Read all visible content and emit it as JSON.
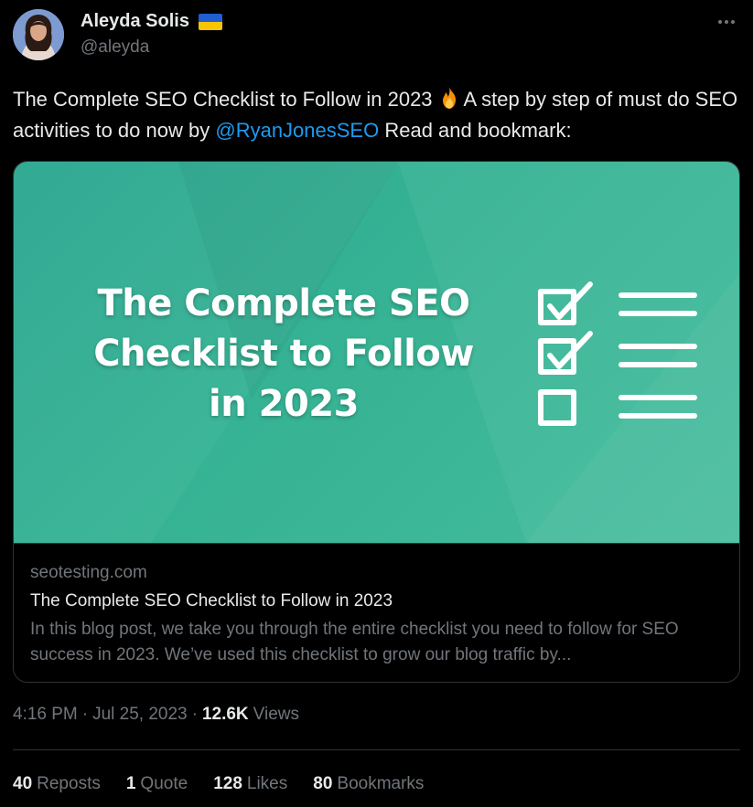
{
  "author": {
    "display_name": "Aleyda Solis",
    "handle": "@aleyda",
    "flag_icon": "ukraine-flag-icon",
    "flag_colors": [
      "#1f5fd0",
      "#f7c600"
    ]
  },
  "tweet": {
    "text_part1": "The Complete SEO Checklist to Follow in 2023",
    "emoji_icon": "fire-emoji-icon",
    "text_part2": "A step by step of must do SEO activities to do now by",
    "mention": "@RyanJonesSEO",
    "text_part3": "Read and bookmark:"
  },
  "card": {
    "image_title_line1": "The Complete SEO",
    "image_title_line2": "Checklist to Follow",
    "image_title_line3": "in 2023",
    "image_icon": "checklist-icon",
    "domain": "seotesting.com",
    "title": "The Complete SEO Checklist to Follow in 2023",
    "description": "In this blog post, we take you through the entire checklist you need to follow for SEO success in 2023. We’ve used this checklist to grow our blog traffic by..."
  },
  "meta": {
    "time": "4:16 PM",
    "separator": "·",
    "date": "Jul 25, 2023",
    "views_count": "12.6K",
    "views_label": "Views"
  },
  "stats": {
    "reposts_count": "40",
    "reposts_label": "Reposts",
    "quotes_count": "1",
    "quotes_label": "Quote",
    "likes_count": "128",
    "likes_label": "Likes",
    "bookmarks_count": "80",
    "bookmarks_label": "Bookmarks"
  },
  "colors": {
    "background": "#000000",
    "text": "#e7e9ea",
    "muted": "#71767b",
    "link": "#1d9bf0",
    "border": "#2f3336",
    "card_teal": "#36b394"
  }
}
